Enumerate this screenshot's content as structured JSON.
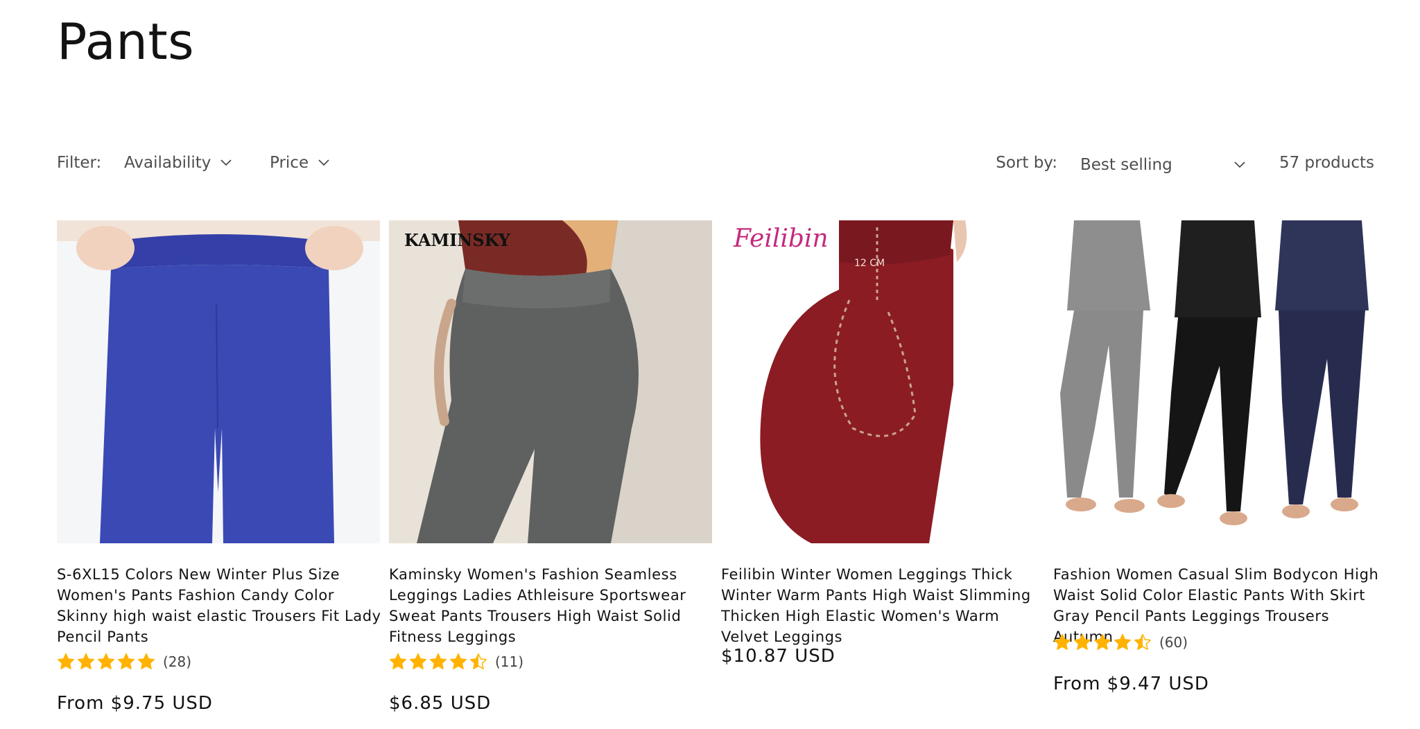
{
  "page": {
    "title": "Pants"
  },
  "toolbar": {
    "filter_label": "Filter:",
    "facets": [
      {
        "label": "Availability"
      },
      {
        "label": "Price"
      }
    ],
    "sort_label": "Sort by:",
    "sort_value": "Best selling",
    "product_count": "57 products"
  },
  "colors": {
    "star": "#ffb300",
    "text": "#121212"
  },
  "products": [
    {
      "title": "S-6XL15 Colors New Winter Plus Size Women's Pants Fashion Candy Color Skinny high waist elastic Trousers Fit Lady Pencil Pants",
      "rating": 5,
      "reviews": "(28)",
      "price": "From $9.75 USD"
    },
    {
      "title": "Kaminsky Women's Fashion Seamless Leggings Ladies Athleisure Sportswear Sweat Pants Trousers High Waist Solid Fitness Leggings",
      "brand_overlay": "KAMINSKY",
      "rating": 4.5,
      "reviews": "(11)",
      "price": "$6.85 USD"
    },
    {
      "title": "Feilibin Winter Women Leggings Thick Winter Warm Pants High Waist Slimming Thicken High Elastic Women's Warm Velvet Leggings",
      "brand_overlay": "Feilibin",
      "measure_overlay": "12 CM",
      "price": "$10.87 USD"
    },
    {
      "title": "Fashion Women Casual Slim Bodycon High Waist Solid Color Elastic Pants With Skirt Gray Pencil Pants Leggings Trousers Autumn",
      "rating": 4.5,
      "reviews": "(60)",
      "price": "From $9.47 USD"
    }
  ]
}
